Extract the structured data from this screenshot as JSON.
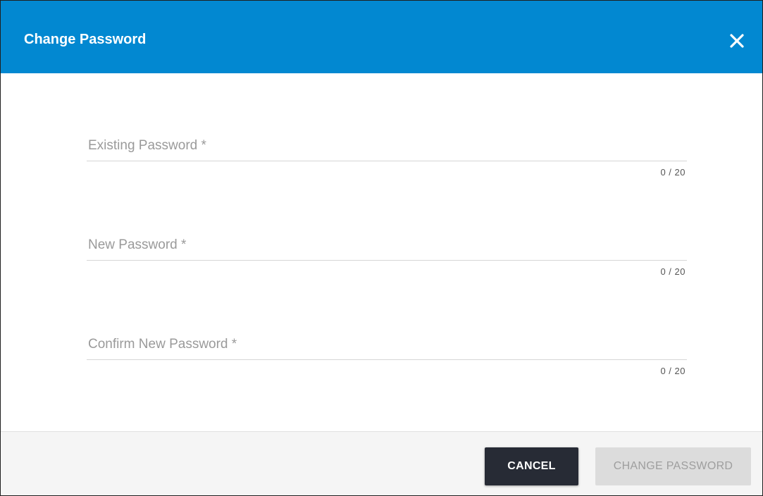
{
  "dialog": {
    "title": "Change Password",
    "close_icon": "close-icon",
    "header_color": "#0288d1"
  },
  "form": {
    "fields": [
      {
        "placeholder": "Existing Password *",
        "value": "",
        "counter": "0 / 20"
      },
      {
        "placeholder": "New Password *",
        "value": "",
        "counter": "0 / 20"
      },
      {
        "placeholder": "Confirm New Password *",
        "value": "",
        "counter": "0 / 20"
      }
    ]
  },
  "footer": {
    "cancel_label": "CANCEL",
    "change_label": "CHANGE PASSWORD",
    "change_disabled": true
  }
}
